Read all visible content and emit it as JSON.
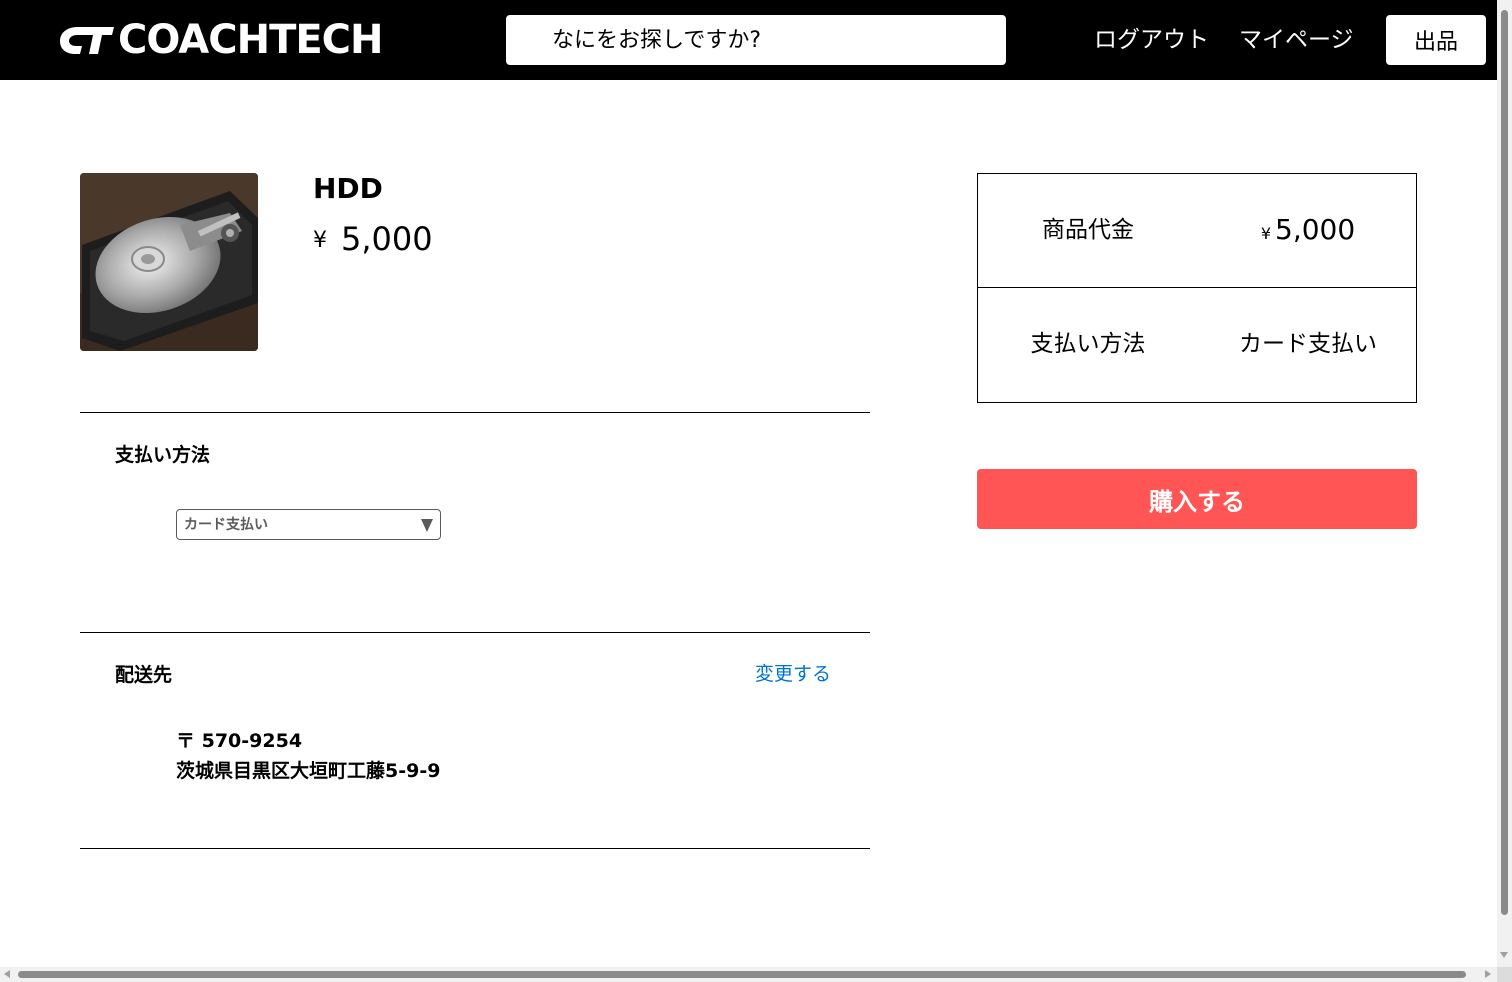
{
  "header": {
    "logo_text": "COACHTECH",
    "search_placeholder": "なにをお探しですか?",
    "logout_label": "ログアウト",
    "mypage_label": "マイページ",
    "sell_label": "出品"
  },
  "product": {
    "name": "HDD",
    "currency": "¥",
    "price": "5,000",
    "image_icon": "hdd-photo"
  },
  "payment": {
    "title": "支払い方法",
    "selected": "カード支払い"
  },
  "shipping": {
    "title": "配送先",
    "change_label": "変更する",
    "postal": "〒 570-9254",
    "address": "茨城県目黒区大垣町工藤5-9-9"
  },
  "summary": {
    "price_label": "商品代金",
    "price_currency": "¥",
    "price_value": "5,000",
    "payment_label": "支払い方法",
    "payment_value": "カード支払い"
  },
  "buy_label": "購入する",
  "colors": {
    "header_bg": "#000000",
    "buy_button": "#ff5555",
    "link": "#0073cc"
  }
}
